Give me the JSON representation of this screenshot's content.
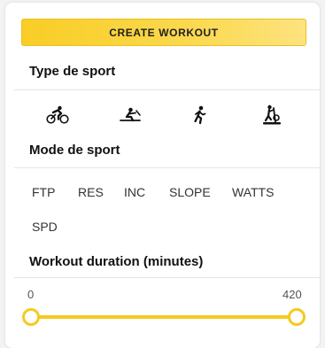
{
  "actions": {
    "create_workout_label": "CREATE WORKOUT"
  },
  "sport_type": {
    "title": "Type de sport",
    "options": [
      {
        "icon": "cycling-icon"
      },
      {
        "icon": "rowing-icon"
      },
      {
        "icon": "running-icon"
      },
      {
        "icon": "elliptical-icon"
      }
    ]
  },
  "sport_mode": {
    "title": "Mode de sport",
    "options": [
      "FTP",
      "RES",
      "INC",
      "SLOPE",
      "WATTS",
      "SPD"
    ]
  },
  "duration": {
    "title": "Workout duration (minutes)",
    "min_label": "0",
    "max_label": "420",
    "range_min": 0,
    "range_max": 420,
    "selected_low": 0,
    "selected_high": 420
  },
  "colors": {
    "accent": "#f5ca1f",
    "button_gradient_start": "#f9cd25",
    "button_gradient_end": "#fde37f"
  }
}
